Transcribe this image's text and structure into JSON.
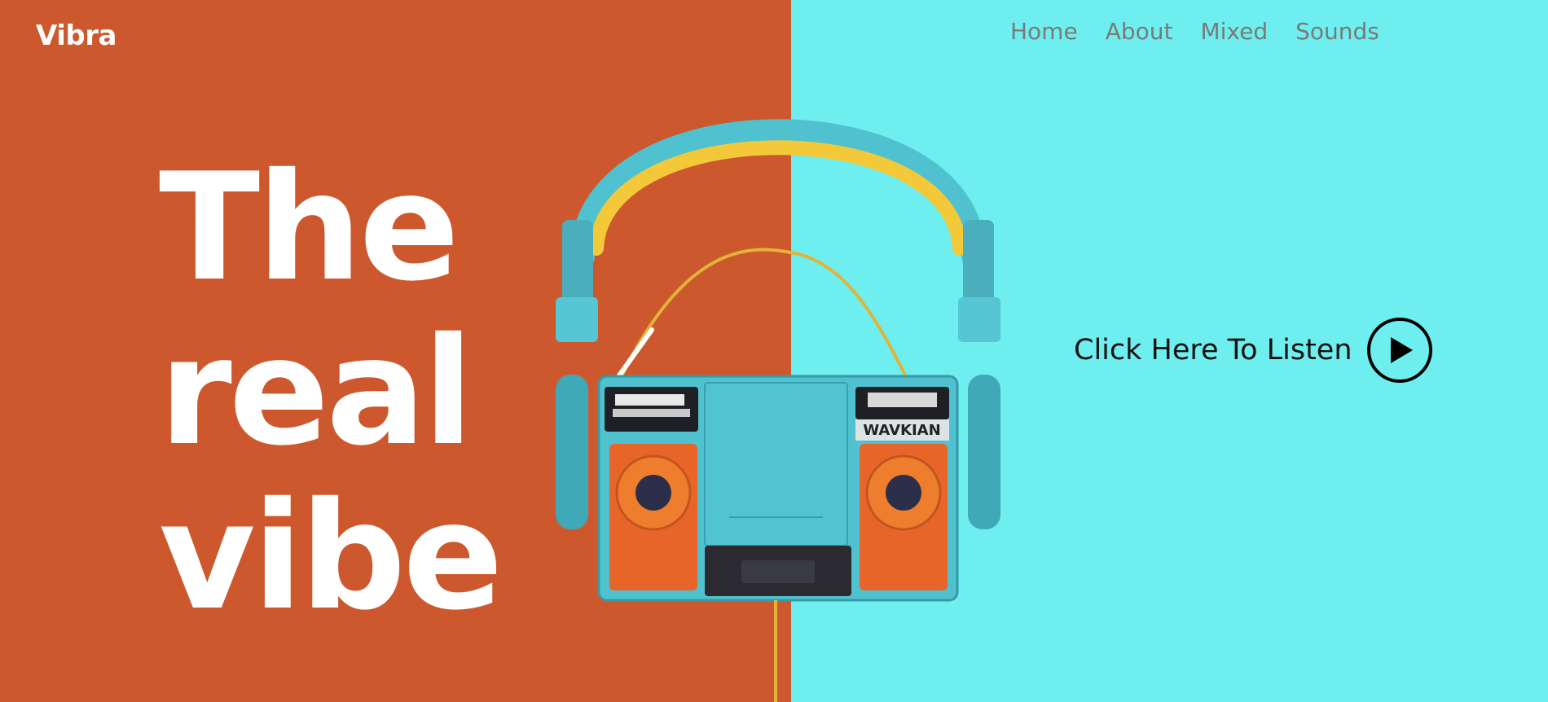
{
  "brand": {
    "logo": "Vibra"
  },
  "nav": {
    "items": [
      {
        "label": "Home"
      },
      {
        "label": "About"
      },
      {
        "label": "Mixed"
      },
      {
        "label": "Sounds"
      }
    ]
  },
  "hero": {
    "lines": [
      "The",
      "real",
      "vibe"
    ],
    "cta_label": "Click Here To Listen"
  },
  "product": {
    "label_text": "WAVKIAN"
  },
  "colors": {
    "left_panel": "#cd582e",
    "right_panel": "#6eeeee",
    "headband": "#f3c93a",
    "device_body": "#4fc1cf",
    "speaker": "#e8652a"
  }
}
